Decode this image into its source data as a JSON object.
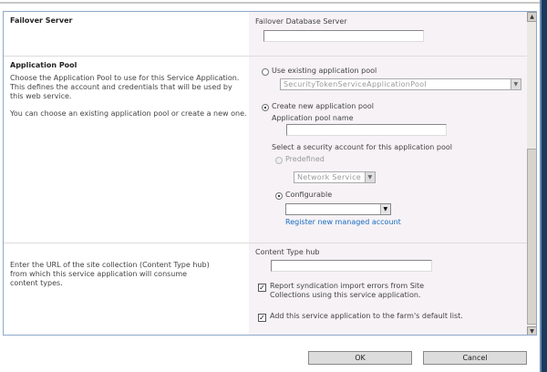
{
  "failover": {
    "heading": "Failover Server",
    "db_label": "Failover Database Server",
    "db_value": ""
  },
  "app_pool": {
    "heading": "Application Pool",
    "desc1": "Choose the Application Pool to use for this Service Application.  This defines the account and credentials that will be used by this web service.",
    "desc2": "You can choose an existing application pool or create a new one.",
    "use_existing_label": "Use existing application pool",
    "existing_pool_value": "SecurityTokenServiceApplicationPool",
    "create_new_label": "Create new application pool",
    "pool_name_label": "Application pool name",
    "pool_name_value": "",
    "security_label": "Select a security account for this application pool",
    "predefined_label": "Predefined",
    "predefined_value": "Network Service",
    "configurable_label": "Configurable",
    "configurable_value": "",
    "register_link": "Register new managed account"
  },
  "content_type": {
    "desc": "Enter the URL of the site collection (Content Type hub) from which this service application will consume content types.",
    "hub_label": "Content Type hub",
    "hub_value": "",
    "report_errors_label": "Report syndication import errors from Site Collections using this service application.",
    "report_errors_checked": true,
    "default_list_label": "Add this service application to the farm's default list.",
    "default_list_checked": true
  },
  "buttons": {
    "ok": "OK",
    "cancel": "Cancel"
  }
}
